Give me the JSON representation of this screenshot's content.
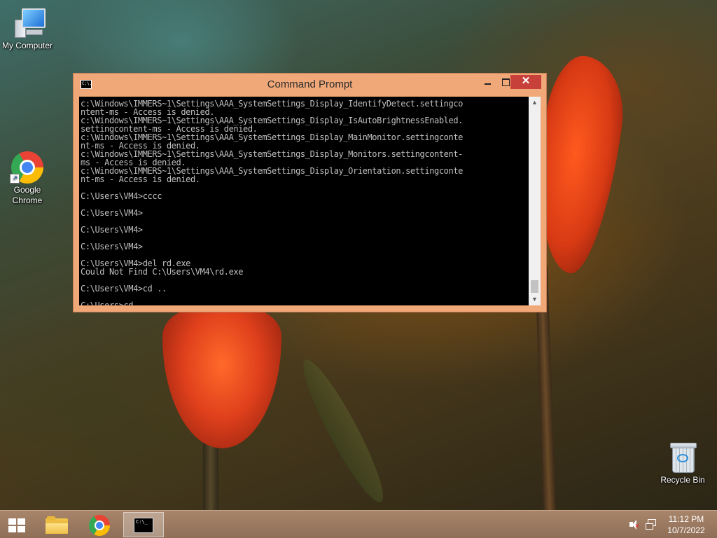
{
  "desktop": {
    "icons": [
      {
        "label": "My Computer",
        "icon": "my-computer-icon"
      },
      {
        "label": "Google Chrome",
        "icon": "chrome-icon",
        "shortcut": true
      },
      {
        "label": "Recycle Bin",
        "icon": "recycle-bin-icon"
      }
    ]
  },
  "window": {
    "title": "Command Prompt",
    "title_icon_text": "C:\\.",
    "buttons": {
      "minimize": "minimize",
      "maximize": "maximize",
      "close": "✕"
    },
    "console": {
      "lines": [
        "c:\\Windows\\IMMERS~1\\Settings\\AAA_SystemSettings_Display_IdentifyDetect.settingco",
        "ntent-ms - Access is denied.",
        "c:\\Windows\\IMMERS~1\\Settings\\AAA_SystemSettings_Display_IsAutoBrightnessEnabled.",
        "settingcontent-ms - Access is denied.",
        "c:\\Windows\\IMMERS~1\\Settings\\AAA_SystemSettings_Display_MainMonitor.settingconte",
        "nt-ms - Access is denied.",
        "c:\\Windows\\IMMERS~1\\Settings\\AAA_SystemSettings_Display_Monitors.settingcontent-",
        "ms - Access is denied.",
        "c:\\Windows\\IMMERS~1\\Settings\\AAA_SystemSettings_Display_Orientation.settingconte",
        "nt-ms - Access is denied.",
        "",
        "C:\\Users\\VM4>cccc",
        "",
        "C:\\Users\\VM4>",
        "",
        "C:\\Users\\VM4>",
        "",
        "C:\\Users\\VM4>",
        "",
        "C:\\Users\\VM4>del rd.exe",
        "Could Not Find C:\\Users\\VM4\\rd.exe",
        "",
        "C:\\Users\\VM4>cd ..",
        "",
        "C:\\Users>cd."
      ]
    },
    "colors": {
      "frame": "#f0a878",
      "close": "#c7413a",
      "console_bg": "#000000",
      "console_fg": "#c0c0c0"
    }
  },
  "taskbar": {
    "pinned": [
      {
        "name": "start",
        "icon": "windows-logo-icon"
      },
      {
        "name": "file-explorer",
        "icon": "folder-icon"
      },
      {
        "name": "chrome",
        "icon": "chrome-icon"
      },
      {
        "name": "command-prompt",
        "icon": "cmd-icon",
        "active": true
      }
    ],
    "cmd_glyph_text": "C:\\_",
    "tray": {
      "volume_icon": "volume-muted-icon",
      "network_icon": "network-icon",
      "time": "11:12 PM",
      "date": "10/7/2022"
    }
  }
}
